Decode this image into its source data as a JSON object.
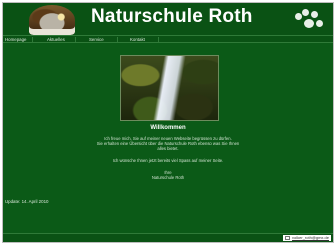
{
  "header": {
    "title": "Naturschule Roth",
    "logo_icon": "eagle-icon",
    "decor_icon": "paw-print-icon"
  },
  "nav": {
    "items": [
      {
        "label": "Homepage"
      },
      {
        "label": "Aktuelles"
      },
      {
        "label": "Service"
      },
      {
        "label": "Kontakt"
      }
    ]
  },
  "main": {
    "image": "waterfall-photo",
    "welcome_title": "Willkommen",
    "intro_line1": "Ich freue mich, Sie auf meiner neuen Webseite begrüssen zu dürfen.",
    "intro_line2": "Sie erhalten eine Übersicht über die Naturschule Roth ebenso was Sie Ihnen",
    "intro_line3": "alles bietet.",
    "wish": "Ich wünsche Ihnen jetzt bereits viel Spass auf meiner Seite.",
    "sign_off": "Ihre",
    "signature": "Naturschule Roth",
    "update": "Update: 14. April 2010"
  },
  "footer": {
    "email": "volker_roth@gmx.de",
    "email_icon": "mail-icon"
  },
  "colors": {
    "background": "#0b5a17",
    "header": "#0a5214",
    "text": "#ffffff"
  }
}
